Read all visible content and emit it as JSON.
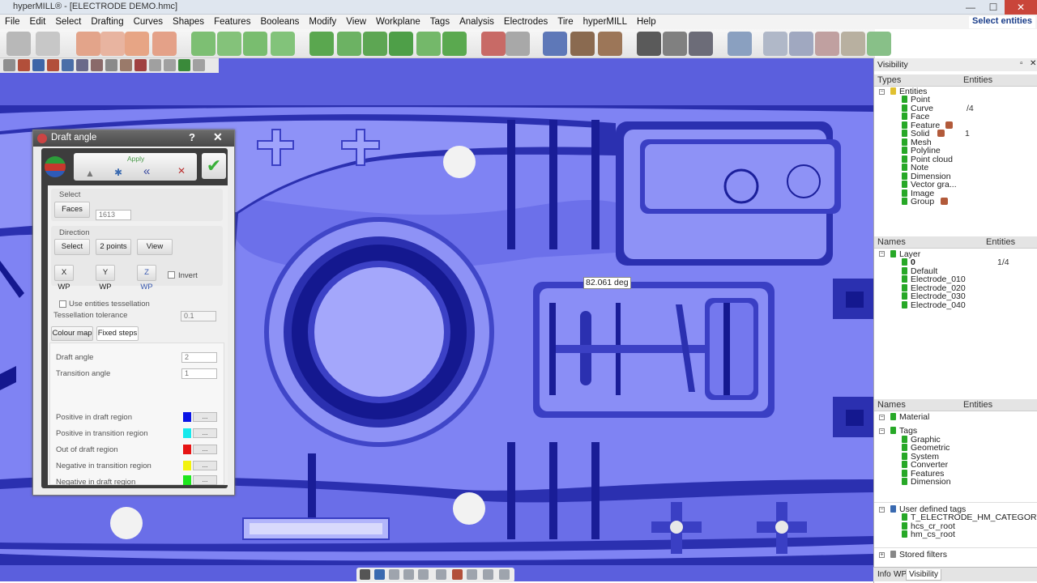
{
  "window": {
    "title": "hyperMILL® - [ELECTRODE DEMO.hmc]",
    "min": "—",
    "max": "☐",
    "close": "✕"
  },
  "menu": [
    "File",
    "Edit",
    "Select",
    "Drafting",
    "Curves",
    "Shapes",
    "Features",
    "Booleans",
    "Modify",
    "View",
    "Workplane",
    "Tags",
    "Analysis",
    "Electrodes",
    "Tire",
    "hyperMILL",
    "Help"
  ],
  "select_entities": "Select entities",
  "tooltip": "82.061 deg",
  "draft_panel": {
    "title": "Draft angle",
    "help": "?",
    "close": "✕",
    "apply_label": "Apply",
    "select_group": "Select",
    "faces_button": "Faces",
    "faces_count": "1613",
    "direction_group": "Direction",
    "dir_select": "Select",
    "dir_2points": "2 points",
    "dir_view": "View",
    "xwp": "X WP",
    "ywp": "Y WP",
    "zwp": "Z WP",
    "invert": "Invert",
    "use_tess": "Use entities tessellation",
    "tess_tol": "Tessellation tolerance",
    "tess_tol_value": "0.1",
    "tab_colour": "Colour map",
    "tab_fixed": "Fixed steps",
    "draft_angle_label": "Draft angle",
    "draft_angle_value": "2",
    "transition_label": "Transition angle",
    "transition_value": "1",
    "regions": [
      {
        "label": "Positive in draft region",
        "color": "#0a14e6"
      },
      {
        "label": "Positive in transition region",
        "color": "#16e9ec"
      },
      {
        "label": "Out of draft region",
        "color": "#e61414"
      },
      {
        "label": "Negative in transition region",
        "color": "#f2f20e"
      },
      {
        "label": "Negative in draft region",
        "color": "#1ee61e"
      }
    ],
    "ellipsis": "..."
  },
  "visibility": {
    "title": "Visibility",
    "types_header": "Types",
    "entities_header": "Entities",
    "types": [
      {
        "label": "Entities",
        "count": ""
      },
      {
        "label": "Point",
        "count": ""
      },
      {
        "label": "Curve",
        "count": "/4"
      },
      {
        "label": "Face",
        "count": ""
      },
      {
        "label": "Feature",
        "count": ""
      },
      {
        "label": "Solid",
        "count": "1"
      },
      {
        "label": "Mesh",
        "count": ""
      },
      {
        "label": "Polyline",
        "count": ""
      },
      {
        "label": "Point cloud",
        "count": ""
      },
      {
        "label": "Note",
        "count": ""
      },
      {
        "label": "Dimension",
        "count": ""
      },
      {
        "label": "Vector gra...",
        "count": ""
      },
      {
        "label": "Image",
        "count": ""
      },
      {
        "label": "Group",
        "count": ""
      }
    ],
    "names_header": "Names",
    "layers": [
      {
        "label": "Layer",
        "count": ""
      },
      {
        "label": "0",
        "count": "1/4"
      },
      {
        "label": "Default",
        "count": ""
      },
      {
        "label": "Electrode_010",
        "count": ""
      },
      {
        "label": "Electrode_020",
        "count": ""
      },
      {
        "label": "Electrode_030",
        "count": ""
      },
      {
        "label": "Electrode_040",
        "count": ""
      }
    ],
    "names_header2": "Names",
    "entities_header2": "Entities",
    "material": "Material",
    "tags": [
      "Tags",
      "Graphic",
      "Geometric",
      "System",
      "Converter",
      "Features",
      "Dimension"
    ],
    "user_tags": [
      "User defined tags",
      "T_ELECTRODE_HM_CATEGORY",
      "hcs_cr_root",
      "hm_cs_root"
    ],
    "stored_filters": "Stored filters",
    "tabs": [
      "Info",
      "WP",
      "Visibility"
    ]
  }
}
